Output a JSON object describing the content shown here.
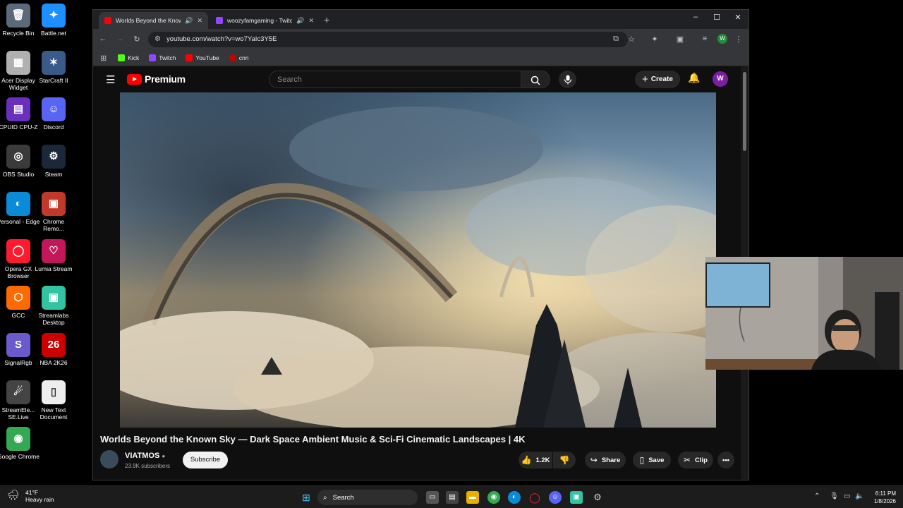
{
  "desktop": {
    "icons": [
      {
        "label": "Recycle Bin",
        "icon": "recycle-bin-icon"
      },
      {
        "label": "Battle.net",
        "icon": "battlenet-icon"
      },
      {
        "label": "Acer Display Widget",
        "icon": "acer-icon"
      },
      {
        "label": "StarCraft II",
        "icon": "starcraft-icon"
      },
      {
        "label": "CPUID CPU-Z",
        "icon": "cpuz-icon"
      },
      {
        "label": "Discord",
        "icon": "discord-icon"
      },
      {
        "label": "OBS Studio",
        "icon": "obs-icon"
      },
      {
        "label": "Steam",
        "icon": "steam-icon"
      },
      {
        "label": "Personal - Edge",
        "icon": "edge-icon"
      },
      {
        "label": "Chrome Remo...",
        "icon": "chrome-remote-icon"
      },
      {
        "label": "Opera GX Browser",
        "icon": "opera-icon"
      },
      {
        "label": "Lumia Stream",
        "icon": "lumia-icon"
      },
      {
        "label": "GCC",
        "icon": "gcc-icon"
      },
      {
        "label": "Streamlabs Desktop",
        "icon": "streamlabs-icon"
      },
      {
        "label": "SignalRgb",
        "icon": "signalrgb-icon"
      },
      {
        "label": "NBA 2K26",
        "icon": "nba-icon"
      },
      {
        "label": "StreamEle... SE.Live",
        "icon": "streamelements-icon"
      },
      {
        "label": "New Text Document",
        "icon": "text-document-icon"
      },
      {
        "label": "Google Chrome",
        "icon": "chrome-icon"
      }
    ]
  },
  "browser": {
    "tabs": [
      {
        "title": "Worlds Beyond the Known",
        "color": "#ff0000"
      },
      {
        "title": "woozyfamgaming - Twitch",
        "color": "#9146ff"
      }
    ],
    "url": "youtube.com/watch?v=wo7YaIc3Y5E",
    "profile_initial": "W",
    "bookmarks": [
      {
        "label": "Kick",
        "color": "#53fc18"
      },
      {
        "label": "Twitch",
        "color": "#9146ff"
      },
      {
        "label": "YouTube",
        "color": "#ff0000"
      },
      {
        "label": "cnn",
        "color": "#cc0000"
      }
    ]
  },
  "youtube": {
    "brand": "Premium",
    "search_placeholder": "Search",
    "create_label": "Create",
    "avatar_initial": "W",
    "video_title": "Worlds Beyond the Known Sky — Dark Space Ambient Music & Sci-Fi Cinematic Landscapes | 4K",
    "channel_name": "VIATMOS",
    "subscribers": "23.9K subscribers",
    "subscribe_label": "Subscribe",
    "likes": "1.2K",
    "share_label": "Share",
    "save_label": "Save",
    "clip_label": "Clip"
  },
  "taskbar": {
    "temperature": "41°F",
    "weather": "Heavy rain",
    "search_label": "Search",
    "time": "6:11 PM",
    "date": "1/8/2026"
  }
}
